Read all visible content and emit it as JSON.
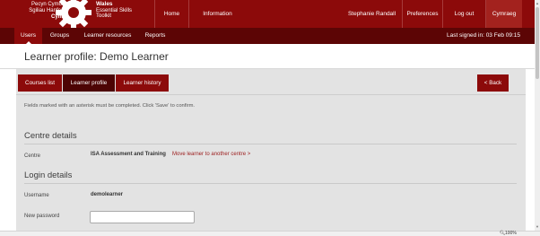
{
  "brand": {
    "line1": "Pecyn Cymorth",
    "line2": "Sgiliau Hanfodol",
    "line3": "Cymru",
    "line4": "Wales",
    "line5": "Essential Skills",
    "line6": "Toolkit"
  },
  "topnav": {
    "home": "Home",
    "information": "Information",
    "user": "Stephanie Randall",
    "preferences": "Preferences",
    "logout": "Log out",
    "language": "Cymraeg"
  },
  "subnav": {
    "users": "Users",
    "groups": "Groups",
    "resources": "Learner resources",
    "reports": "Reports",
    "last_signed": "Last signed in: 03 Feb 09:15"
  },
  "page": {
    "title": "Learner profile: Demo Learner"
  },
  "tabs": {
    "courses": "Courses list",
    "profile": "Learner profile",
    "history": "Learner history",
    "back": "< Back"
  },
  "form": {
    "instructions": "Fields marked with an asterisk must be completed. Click 'Save' to confirm.",
    "centre_heading": "Centre details",
    "centre_label": "Centre",
    "centre_value": "ISA Assessment and Training",
    "move_link": "Move learner to another centre >",
    "login_heading": "Login details",
    "username_label": "Username",
    "username_value": "demolearner",
    "password_label": "New password",
    "password_value": ""
  },
  "statusbar": {
    "zoom": "100%",
    "zoom_icon": "zoom-icon"
  },
  "colors": {
    "brand_red": "#8c0a0a",
    "dark_red": "#5c0505",
    "tab_active": "#4d0404",
    "content_bg": "#e3e3e3"
  }
}
